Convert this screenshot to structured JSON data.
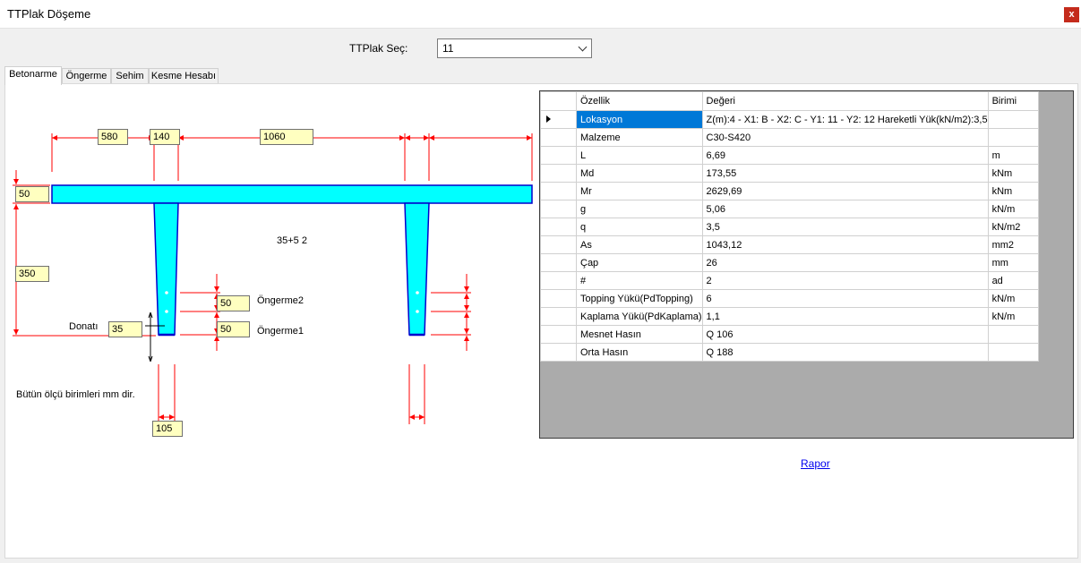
{
  "window": {
    "title": "TTPlak Döşeme",
    "close_label": "x"
  },
  "selector": {
    "label": "TTPlak Seç:",
    "value": "11"
  },
  "tabs": [
    {
      "label": "Betonarme",
      "active": true
    },
    {
      "label": "Öngerme",
      "active": false
    },
    {
      "label": "Sehim",
      "active": false
    },
    {
      "label": "Kesme Hesabı",
      "active": false
    }
  ],
  "drawing": {
    "dim_580": "580",
    "dim_140": "140",
    "dim_1060": "1060",
    "dim_50_top": "50",
    "dim_350": "350",
    "dim_35": "35",
    "dim_105": "105",
    "dim_50_ongerme2": "50",
    "dim_50_ongerme1": "50",
    "label_ongerme2": "Öngerme2",
    "label_ongerme1": "Öngerme1",
    "label_donati": "Donatı",
    "section_code": "35+5 2",
    "note": "Bütün ölçü birimleri mm dir.",
    "colors": {
      "concrete": "#00ffff",
      "outline": "#0000cc",
      "dimension": "#ff0000"
    }
  },
  "grid": {
    "headers": {
      "property": "Özellik",
      "value": "Değeri",
      "unit": "Birimi"
    },
    "rows": [
      {
        "property": "Lokasyon",
        "value": "Z(m):4 - X1: B - X2: C - Y1: 11 - Y2: 12 Hareketli Yük(kN/m2):3,5",
        "unit": "",
        "selected": true
      },
      {
        "property": "Malzeme",
        "value": "C30-S420",
        "unit": ""
      },
      {
        "property": "L",
        "value": "6,69",
        "unit": "m"
      },
      {
        "property": "Md",
        "value": "173,55",
        "unit": "kNm"
      },
      {
        "property": "Mr",
        "value": "2629,69",
        "unit": "kNm"
      },
      {
        "property": "g",
        "value": "5,06",
        "unit": "kN/m"
      },
      {
        "property": "q",
        "value": "3,5",
        "unit": "kN/m2"
      },
      {
        "property": "As",
        "value": "1043,12",
        "unit": "mm2"
      },
      {
        "property": "Çap",
        "value": "26",
        "unit": "mm"
      },
      {
        "property": "#",
        "value": "2",
        "unit": "ad"
      },
      {
        "property": "Topping Yükü(PdTopping)",
        "value": "6",
        "unit": "kN/m"
      },
      {
        "property": "Kaplama Yükü(PdKaplama)",
        "value": "1,1",
        "unit": "kN/m"
      },
      {
        "property": "Mesnet Hasın",
        "value": "Q 106",
        "unit": ""
      },
      {
        "property": "Orta Hasın",
        "value": "Q 188",
        "unit": ""
      }
    ]
  },
  "report_link": "Rapor"
}
